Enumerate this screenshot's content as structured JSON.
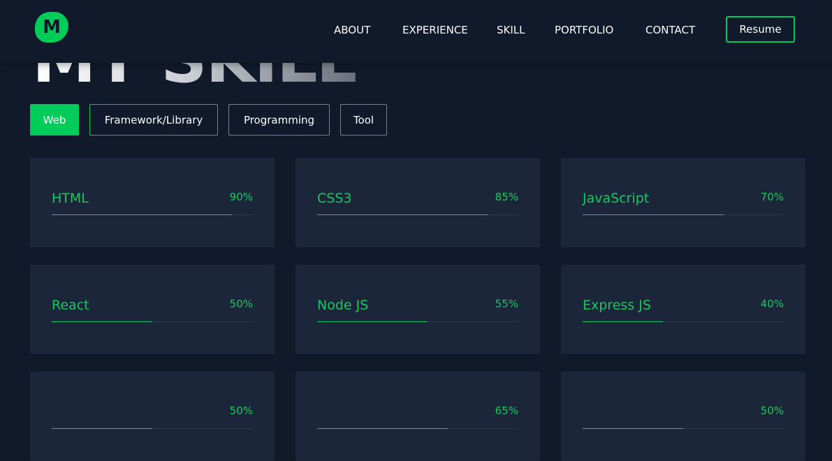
{
  "logo": {
    "letter": "M"
  },
  "nav": {
    "links": [
      "ABOUT",
      "EXPERIENCE",
      "SKILL",
      "PORTFOLIO",
      "CONTACT"
    ],
    "resume_label": "Resume"
  },
  "section": {
    "title": "MY SKILL"
  },
  "tabs": [
    "Web",
    "Framework/Library",
    "Programming",
    "Tool"
  ],
  "skills": [
    {
      "name": "HTML",
      "percent_label": "90%",
      "level": 90
    },
    {
      "name": "CSS3",
      "percent_label": "85%",
      "level": 85
    },
    {
      "name": "JavaScript",
      "percent_label": "70%",
      "level": 70
    },
    {
      "name": "React",
      "percent_label": "50%",
      "level": 50
    },
    {
      "name": "Node JS",
      "percent_label": "55%",
      "level": 55
    },
    {
      "name": "Express JS",
      "percent_label": "40%",
      "level": 40
    },
    {
      "name": "",
      "percent_label": "50%",
      "level": 50
    },
    {
      "name": "",
      "percent_label": "65%",
      "level": 65
    },
    {
      "name": "",
      "percent_label": "50%",
      "level": 50
    }
  ],
  "colors": {
    "accent": "#00cc5a",
    "background": "#111a2b",
    "card": "#1b263a"
  }
}
